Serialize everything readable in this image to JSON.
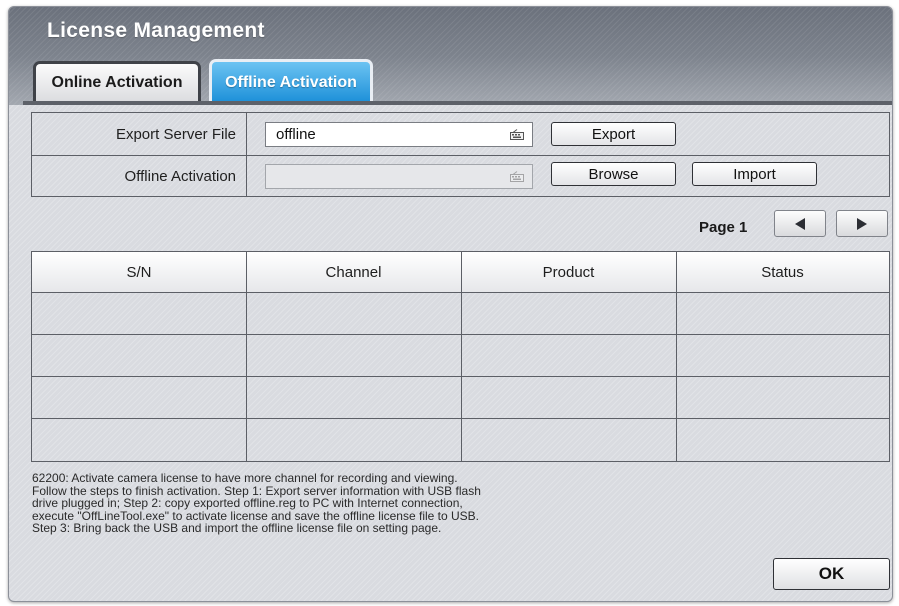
{
  "window": {
    "title": "License Management"
  },
  "tabs": [
    {
      "label": "Online Activation",
      "active": false
    },
    {
      "label": "Offline Activation",
      "active": true
    }
  ],
  "form": {
    "export_row": {
      "label": "Export Server File",
      "value": "offline",
      "icon": "keyboard-icon",
      "button_label": "Export"
    },
    "offline_row": {
      "label": "Offline Activation",
      "value": "",
      "icon": "keyboard-icon",
      "browse_label": "Browse",
      "import_label": "Import"
    }
  },
  "pager": {
    "label": "Page 1",
    "prev_icon": "triangle-left-icon",
    "next_icon": "triangle-right-icon"
  },
  "table": {
    "columns": [
      "S/N",
      "Channel",
      "Product",
      "Status"
    ],
    "rows": [
      [
        "",
        "",
        "",
        ""
      ],
      [
        "",
        "",
        "",
        ""
      ],
      [
        "",
        "",
        "",
        ""
      ],
      [
        "",
        "",
        "",
        ""
      ]
    ]
  },
  "help_text": "62200: Activate camera license to have more channel for recording and viewing. Follow the steps to finish activation. Step 1: Export server information with USB flash drive plugged in; Step 2: copy exported offline.reg to PC with Internet connection, execute \"OffLineTool.exe\" to activate license and save the offline license file to USB. Step 3: Bring back the USB and import the offline license file on setting page.",
  "ok_label": "OK",
  "colors": {
    "active_tab": "#1b8fd8",
    "title_text": "#ffffff",
    "panel_bg": "#d9dbe0"
  }
}
